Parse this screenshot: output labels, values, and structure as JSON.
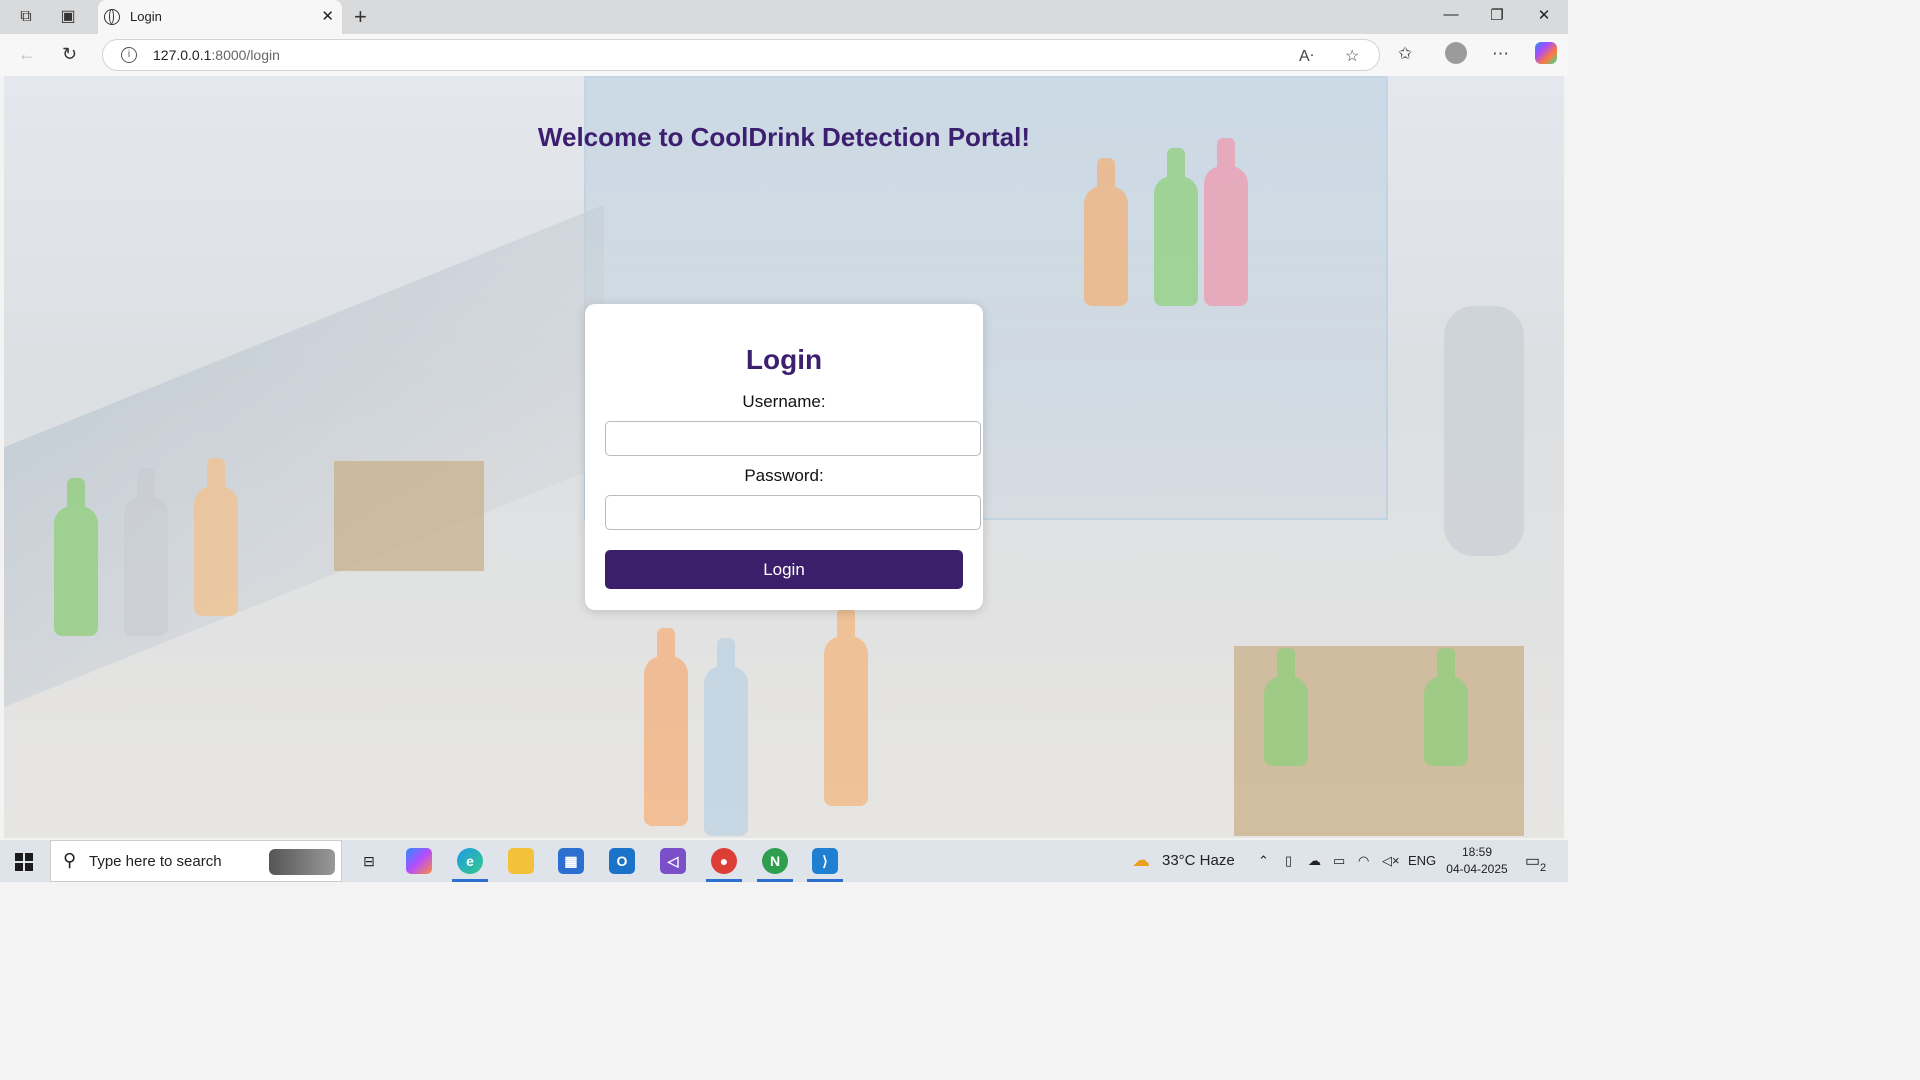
{
  "browser": {
    "tab_title": "Login",
    "url_host": "127.0.0.1",
    "url_path": ":8000/login"
  },
  "page": {
    "heading": "Welcome to CoolDrink Detection Portal!",
    "form": {
      "title": "Login",
      "username_label": "Username:",
      "username_value": "",
      "password_label": "Password:",
      "password_value": "",
      "submit_label": "Login"
    }
  },
  "taskbar": {
    "search_placeholder": "Type here to search",
    "weather": "33°C  Haze",
    "language": "ENG",
    "time": "18:59",
    "date": "04-04-2025",
    "notification_count": "2"
  },
  "colors": {
    "brand": "#3b1f6b",
    "heading": "#3c1f6e"
  }
}
